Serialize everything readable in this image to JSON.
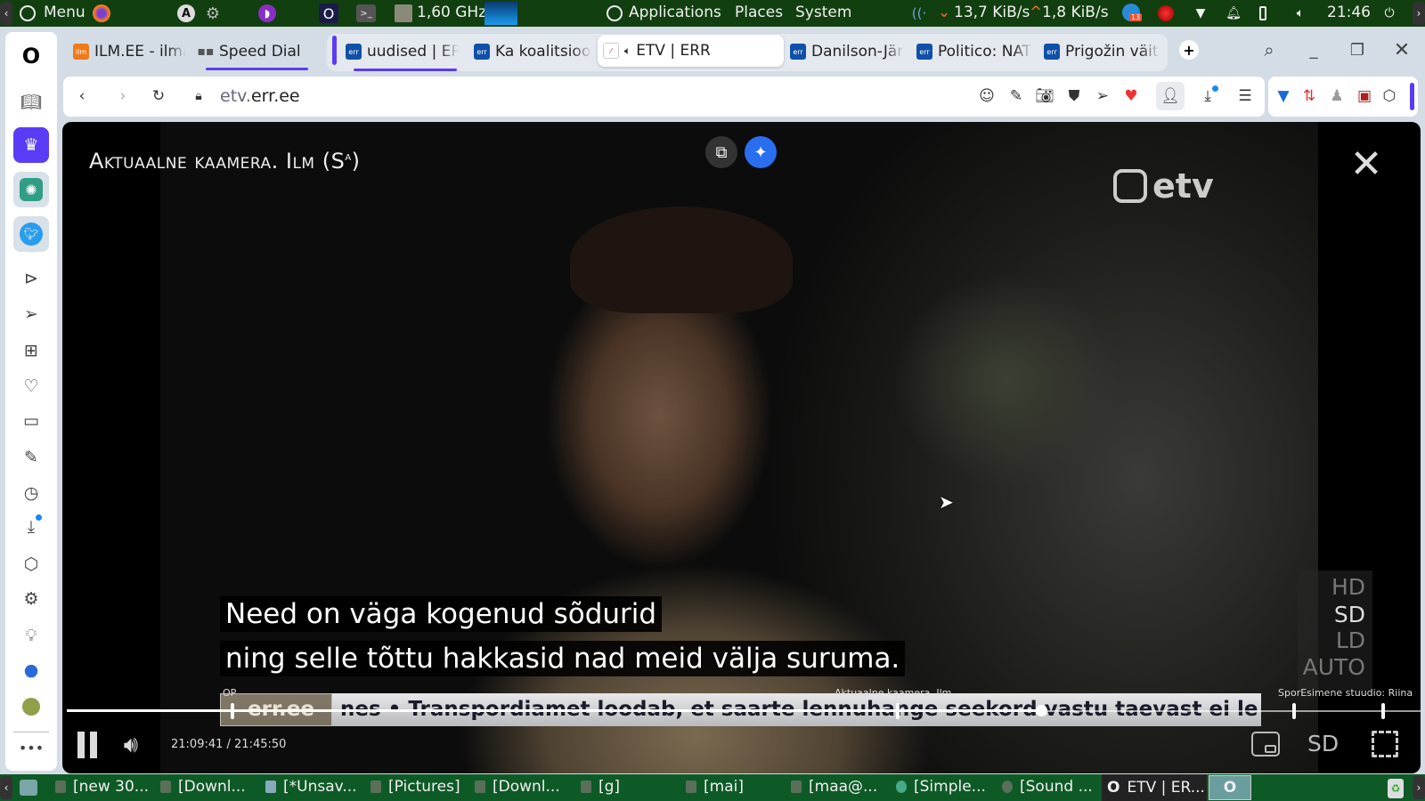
{
  "top_panel": {
    "menu": "Menu",
    "cpu": "1,60 GHz",
    "applications": "Applications",
    "places": "Places",
    "system": "System",
    "net_down": "13,7 KiB/s",
    "net_up": "1,8 KiB/s",
    "telegram_badge": "13",
    "clock": "21:46"
  },
  "tabs": [
    {
      "label": "ILM.EE - ilmateade",
      "favicon": "ilm"
    },
    {
      "label": "Speed Dial",
      "favicon": "grid"
    },
    {
      "label": "uudised | ERR",
      "favicon": "err"
    },
    {
      "label": "Ka koalitsioon",
      "favicon": "err"
    },
    {
      "label": "ETV | ERR",
      "favicon": "etv",
      "active": true
    },
    {
      "label": "Danilson-Järg",
      "favicon": "err"
    },
    {
      "label": "Politico: NATO",
      "favicon": "err"
    },
    {
      "label": "Prigožin väitis",
      "favicon": "err"
    }
  ],
  "address": {
    "url_host": "etv.",
    "url_domain": "err.ee"
  },
  "video": {
    "program_title": "Aktuaalne kaamera. Ilm (S",
    "program_title_sup": "a",
    "channel_logo": "etv",
    "subtitle_line1": "Need on väga kogenud sõdurid",
    "subtitle_line2": "ning selle tõttu hakkasid nad meid välja suruma.",
    "ticker_source": "err.ee",
    "ticker_text": "nes   •   Transpordiamet loodab, et saarte lennuhange seekord vastu taevast ei le",
    "quality_options": [
      "HD",
      "SD",
      "LD",
      "AUTO"
    ],
    "quality_selected": "SD",
    "marker_labels": [
      "OP",
      "Aktuaalne kaamera. Ilm",
      "SporEsimene stuudio: Riina"
    ],
    "time": "21:09:41 / 21:45:50",
    "progress_percent": 72,
    "quality_button": "SD"
  },
  "taskbar": [
    {
      "label": "[new 30..."
    },
    {
      "label": "[Downl..."
    },
    {
      "label": "[*Unsav..."
    },
    {
      "label": "[Pictures]"
    },
    {
      "label": "[Downl..."
    },
    {
      "label": "[g]"
    },
    {
      "label": "[mai]"
    },
    {
      "label": "[maa@..."
    },
    {
      "label": "[Simple..."
    },
    {
      "label": "[Sound ..."
    },
    {
      "label": "ETV | ER..."
    }
  ],
  "colors": {
    "panel": "#123f10",
    "taskbar": "#0e5a27",
    "accent": "#5b3cf6"
  }
}
